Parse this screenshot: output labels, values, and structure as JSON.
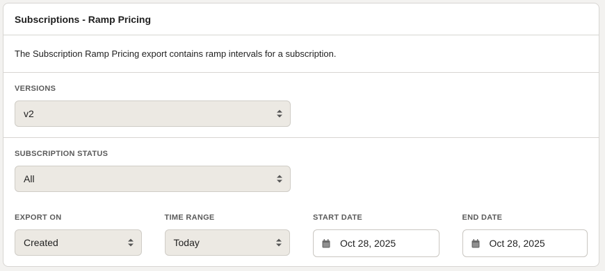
{
  "card": {
    "title": "Subscriptions - Ramp Pricing",
    "description": "The Subscription Ramp Pricing export contains ramp intervals for a subscription."
  },
  "versions": {
    "label": "VERSIONS",
    "value": "v2"
  },
  "subscription_status": {
    "label": "SUBSCRIPTION STATUS",
    "value": "All"
  },
  "export_on": {
    "label": "EXPORT ON",
    "value": "Created"
  },
  "time_range": {
    "label": "TIME RANGE",
    "value": "Today"
  },
  "start_date": {
    "label": "START DATE",
    "value": "Oct 28, 2025",
    "icon": "calendar-icon"
  },
  "end_date": {
    "label": "END DATE",
    "value": "Oct 28, 2025",
    "icon": "calendar-icon"
  },
  "colors": {
    "select_bg": "#ece9e3",
    "border": "#d7d5d2",
    "label": "#5a5a5a"
  }
}
